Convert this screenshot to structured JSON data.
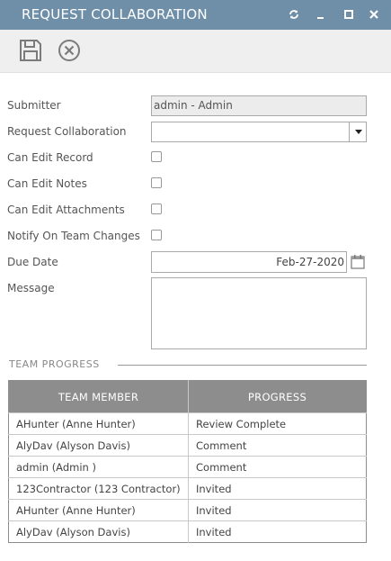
{
  "window": {
    "title": "REQUEST COLLABORATION",
    "controls": [
      "refresh-icon",
      "minimize-icon",
      "maximize-icon",
      "close-icon"
    ]
  },
  "toolbar": {
    "buttons": [
      {
        "name": "save",
        "icon": "floppy-disk-icon"
      },
      {
        "name": "cancel",
        "icon": "circle-x-icon"
      }
    ]
  },
  "form": {
    "submitter": {
      "label": "Submitter",
      "value": "admin - Admin"
    },
    "request_collaboration": {
      "label": "Request Collaboration",
      "value": ""
    },
    "can_edit_record": {
      "label": "Can Edit Record",
      "checked": false
    },
    "can_edit_notes": {
      "label": "Can Edit Notes",
      "checked": false
    },
    "can_edit_attachments": {
      "label": "Can Edit Attachments",
      "checked": false
    },
    "notify_on_team_changes": {
      "label": "Notify On Team Changes",
      "checked": false
    },
    "due_date": {
      "label": "Due Date",
      "value": "Feb-27-2020"
    },
    "message": {
      "label": "Message",
      "value": ""
    }
  },
  "team_progress": {
    "section_title": "TEAM PROGRESS",
    "columns": [
      "TEAM MEMBER",
      "PROGRESS"
    ],
    "rows": [
      [
        "AHunter (Anne Hunter)",
        "Review Complete"
      ],
      [
        "AlyDav (Alyson Davis)",
        "Comment"
      ],
      [
        "admin (Admin )",
        "Comment"
      ],
      [
        "123Contractor (123 Contractor)",
        "Invited"
      ],
      [
        "AHunter (Anne Hunter)",
        "Invited"
      ],
      [
        "AlyDav (Alyson Davis)",
        "Invited"
      ]
    ]
  },
  "colors": {
    "titlebar": "#6f8ea8",
    "toolbar": "#efefef",
    "table_header": "#8d8d8d"
  }
}
